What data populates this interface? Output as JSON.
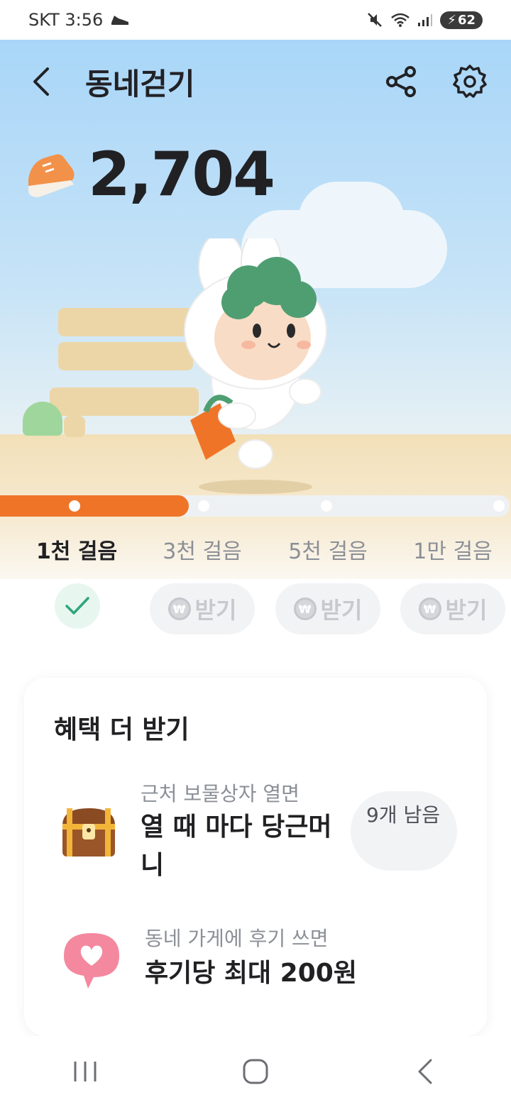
{
  "status_bar": {
    "carrier_time": "SKT 3:56",
    "battery": "62",
    "icons": [
      "shoe-icon",
      "mute-icon",
      "wifi-icon",
      "signal-icon",
      "battery-icon"
    ]
  },
  "header": {
    "title": "동네걷기",
    "icons": [
      "back-arrow-icon",
      "share-icon",
      "gear-icon"
    ]
  },
  "steps": {
    "count": "2,704",
    "icon": "sneaker-icon"
  },
  "progress": {
    "fraction": 0.37,
    "accent_color": "#f07428",
    "milestones": [
      {
        "label": "1천 걸음",
        "status": "claimed"
      },
      {
        "label": "3천 걸음",
        "status": "locked"
      },
      {
        "label": "5천 걸음",
        "status": "locked"
      },
      {
        "label": "1만 걸음",
        "status": "locked"
      }
    ]
  },
  "rewards": {
    "claim_label": "받기",
    "coin_symbol": "₩",
    "claimed_icon": "check-icon"
  },
  "benefits": {
    "title": "혜택 더 받기",
    "items": [
      {
        "subtitle": "근처 보물상자 열면",
        "main": "열 때 마다 당근머니",
        "badge": "9개 남음",
        "icon": "treasure-chest-icon"
      },
      {
        "subtitle": "동네 가게에 후기 쓰면",
        "main": "후기당 최대 200원",
        "icon": "heart-speech-bubble-icon"
      }
    ]
  },
  "nav": {
    "icons": [
      "recent-apps-icon",
      "home-icon",
      "back-icon"
    ]
  }
}
